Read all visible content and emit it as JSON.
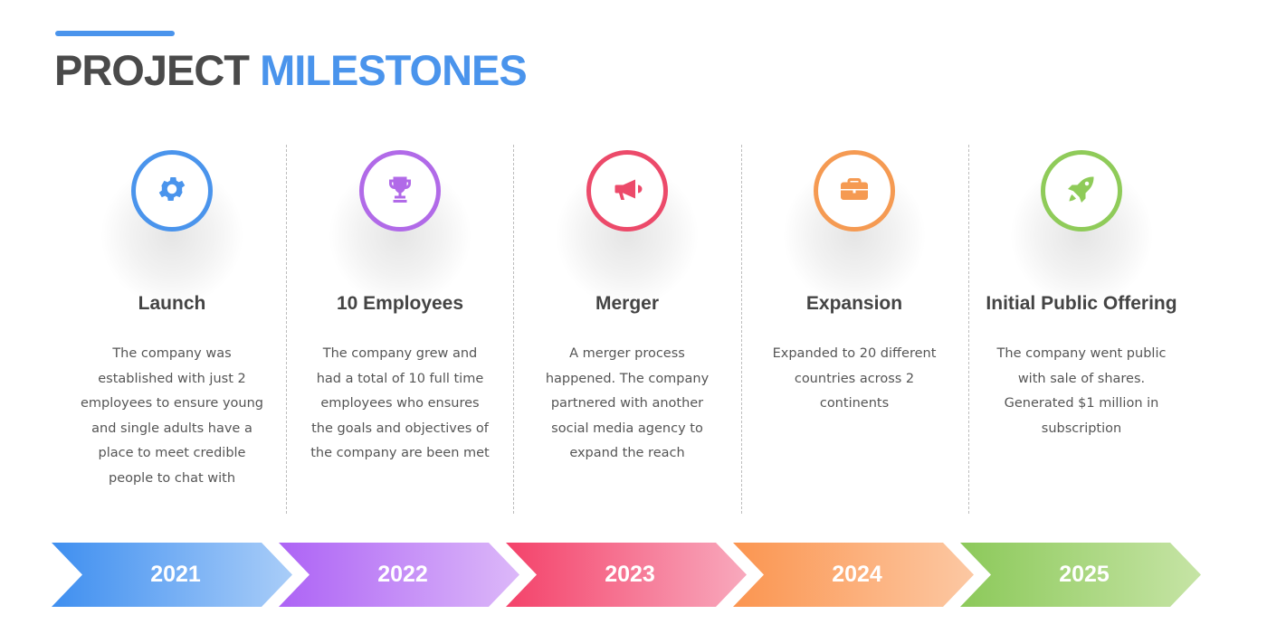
{
  "header": {
    "title_part1": "PROJECT",
    "title_part2": "MILESTONES",
    "accent_color": "#4a94ec"
  },
  "milestones": [
    {
      "title": "Launch",
      "icon": "gear-icon",
      "color": "#4a94ec",
      "description": [
        "The company was",
        "established with just 2",
        "employees to ensure young",
        "and single adults have a",
        "place to meet credible",
        "people to chat with"
      ],
      "year": "2021",
      "gradient": [
        "#3f8ff0",
        "#a9cdf8"
      ]
    },
    {
      "title": "10 Employees",
      "icon": "trophy-icon",
      "color": "#b16ae8",
      "description": [
        "The company grew and",
        "had a total of 10 full time",
        "employees who ensures",
        "the goals and objectives of",
        "the company are been met"
      ],
      "year": "2022",
      "gradient": [
        "#ad63f5",
        "#dcb8f9"
      ]
    },
    {
      "title": "Merger",
      "icon": "megaphone-icon",
      "color": "#ec4a6a",
      "description": [
        "A merger process",
        "happened. The company",
        "partnered with another",
        "social media agency to",
        "expand the reach"
      ],
      "year": "2023",
      "gradient": [
        "#f4426a",
        "#f8a9bd"
      ]
    },
    {
      "title": "Expansion",
      "icon": "briefcase-icon",
      "color": "#f59a52",
      "description": [
        "Expanded to 20 different",
        "countries across 2",
        "continents"
      ],
      "year": "2024",
      "gradient": [
        "#fb9550",
        "#fcc8a3"
      ]
    },
    {
      "title": "Initial Public Offering",
      "icon": "rocket-icon",
      "color": "#8fcb59",
      "description": [
        "The company went public",
        "with sale of shares.",
        "Generated $1 million in",
        "subscription"
      ],
      "year": "2025",
      "gradient": [
        "#8cc95a",
        "#c6e4a5"
      ]
    }
  ]
}
